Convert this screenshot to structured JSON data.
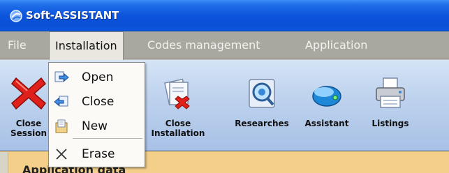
{
  "window": {
    "title": "Soft-ASSISTANT"
  },
  "menubar": {
    "items": [
      {
        "label": "File"
      },
      {
        "label": "Installation"
      },
      {
        "label": "Codes management"
      },
      {
        "label": "Application"
      }
    ]
  },
  "dropdown": {
    "items": [
      {
        "label": "Open",
        "icon": "open-arrow-icon"
      },
      {
        "label": "Close",
        "icon": "close-arrow-icon"
      },
      {
        "label": "New",
        "icon": "new-document-icon"
      },
      {
        "label": "Erase",
        "icon": "erase-x-icon"
      }
    ]
  },
  "toolbar": {
    "close_session": {
      "line1": "Close",
      "line2": "Session"
    },
    "close_installation": {
      "line1": "Close",
      "line2": "Installation"
    },
    "researches": "Researches",
    "assistant": "Assistant",
    "listings": "Listings"
  },
  "content": {
    "heading": "Application data"
  },
  "colors": {
    "titlebar": "#0d55dd",
    "menubar": "#a9a89f",
    "toolbar": "#bfd3ee",
    "content": "#f3cf8a"
  }
}
